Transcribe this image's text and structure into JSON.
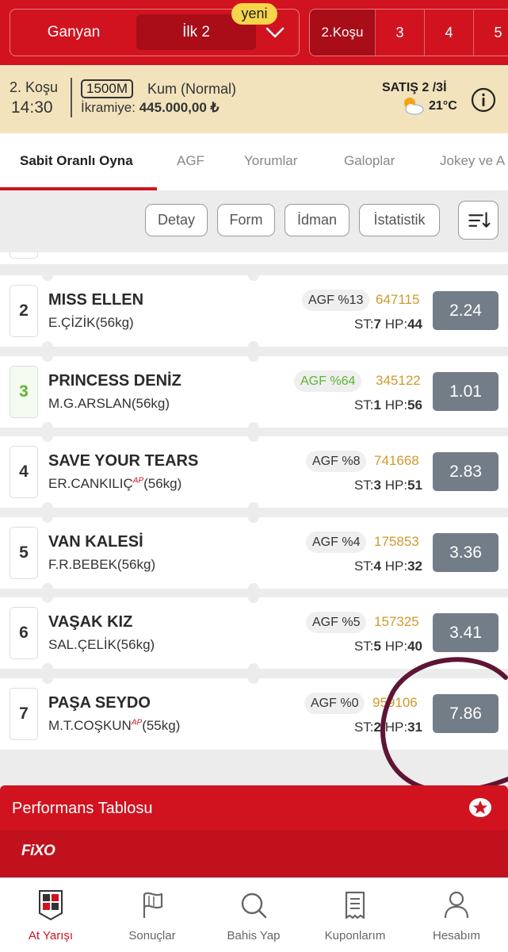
{
  "header": {
    "bet_types": [
      "Ganyan",
      "İlk 2"
    ],
    "new_badge": "yeni",
    "race_tabs": [
      "2.Koşu",
      "3",
      "4",
      "5"
    ],
    "colors": {
      "primary_red": "#d1131f",
      "dark_red": "#a80d18",
      "badge_yellow": "#f6d54a"
    }
  },
  "race_info": {
    "race_no": "2. Koşu",
    "time": "14:30",
    "distance": "1500M",
    "surface": "Kum (Normal)",
    "prize_label": "İkramiye:",
    "prize_value": "445.000,00 ₺",
    "sales": "SATIŞ 2  /3İ",
    "temperature": "21°C",
    "weather_icon": "partly-cloudy-icon"
  },
  "tabs": [
    "Sabit Oranlı Oyna",
    "AGF",
    "Yorumlar",
    "Galoplar",
    "Jokey ve A"
  ],
  "filters": [
    "Detay",
    "Form",
    "İdman",
    "İstatistik"
  ],
  "horses": [
    {
      "no": "2",
      "name": "MISS ELLEN",
      "jockey": "E.ÇİZİK",
      "ap": "",
      "weight": "(56kg)",
      "agf": "AGF %13",
      "count": "647115",
      "st": "7",
      "hp": "44",
      "odds": "2.24",
      "fav": false
    },
    {
      "no": "3",
      "name": "PRINCESS DENİZ",
      "jockey": "M.G.ARSLAN",
      "ap": "",
      "weight": "(56kg)",
      "agf": "AGF %64",
      "count": "345122",
      "st": "1",
      "hp": "56",
      "odds": "1.01",
      "fav": true
    },
    {
      "no": "4",
      "name": "SAVE YOUR TEARS",
      "jockey": "ER.CANKILIÇ",
      "ap": "AP",
      "weight": "(56kg)",
      "agf": "AGF %8",
      "count": "741668",
      "st": "3",
      "hp": "51",
      "odds": "2.83",
      "fav": false
    },
    {
      "no": "5",
      "name": "VAN KALESİ",
      "jockey": "F.R.BEBEK",
      "ap": "",
      "weight": "(56kg)",
      "agf": "AGF %4",
      "count": "175853",
      "st": "4",
      "hp": "32",
      "odds": "3.36",
      "fav": false
    },
    {
      "no": "6",
      "name": "VAŞAK KIZ",
      "jockey": "SAL.ÇELİK",
      "ap": "",
      "weight": "(56kg)",
      "agf": "AGF %5",
      "count": "157325",
      "st": "5",
      "hp": "40",
      "odds": "3.41",
      "fav": false
    },
    {
      "no": "7",
      "name": "PAŞA SEYDO",
      "jockey": "M.T.COŞKUN",
      "ap": "AP",
      "weight": "(55kg)",
      "agf": "AGF %0",
      "count": "959106",
      "st": "2",
      "hp": "31",
      "odds": "7.86",
      "fav": false
    }
  ],
  "labels": {
    "st": "ST:",
    "hp": "HP:"
  },
  "performance": {
    "title": "Performans Tablosu"
  },
  "fixo": {
    "logo": "FiXO"
  },
  "bottom_nav": [
    {
      "label": "At Yarışı",
      "icon": "horse-racing-logo-icon",
      "active": true
    },
    {
      "label": "Sonuçlar",
      "icon": "flag-icon",
      "active": false
    },
    {
      "label": "Bahis Yap",
      "icon": "search-icon",
      "active": false
    },
    {
      "label": "Kuponlarım",
      "icon": "receipt-icon",
      "active": false
    },
    {
      "label": "Hesabım",
      "icon": "user-icon",
      "active": false
    }
  ]
}
